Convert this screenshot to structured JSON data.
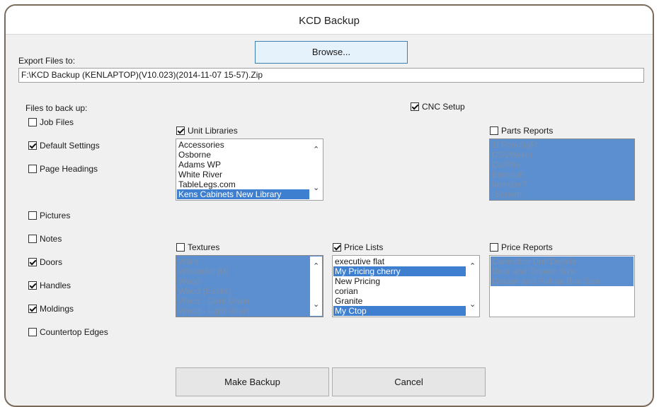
{
  "window": {
    "title": "KCD Backup"
  },
  "export": {
    "label": "Export Files to:",
    "browse_label": "Browse...",
    "path": "F:\\KCD Backup (KENLAPTOP)(V10.023)(2014-11-07 15-57).Zip"
  },
  "files": {
    "heading": "Files to back up:",
    "items": [
      {
        "label": "Job Files",
        "checked": false
      },
      {
        "label": "Default Settings",
        "checked": true
      },
      {
        "label": "Page Headings",
        "checked": false
      },
      {
        "label": "Pictures",
        "checked": false
      },
      {
        "label": "Notes",
        "checked": false
      },
      {
        "label": "Doors",
        "checked": true
      },
      {
        "label": "Handles",
        "checked": true
      },
      {
        "label": "Moldings",
        "checked": true
      },
      {
        "label": "Countertop Edges",
        "checked": false
      }
    ]
  },
  "cnc": {
    "label": "CNC Setup",
    "checked": true
  },
  "unit_libraries": {
    "label": "Unit Libraries",
    "checked": true,
    "items": [
      {
        "text": "Accessories",
        "sel": false
      },
      {
        "text": "Osborne",
        "sel": false
      },
      {
        "text": "Adams WP",
        "sel": false
      },
      {
        "text": "White River",
        "sel": false
      },
      {
        "text": "TableLegs.com",
        "sel": false
      },
      {
        "text": "Kens Cabinets New Library",
        "sel": true
      }
    ]
  },
  "parts_reports": {
    "label": "Parts Reports",
    "checked": false,
    "items": [
      {
        "text": "1f Frm-SqFt",
        "sel": true
      },
      {
        "text": "CSVMaker",
        "sel": true
      },
      {
        "text": "CutRite",
        "sel": true
      },
      {
        "text": "Eurosoft",
        "sel": true
      },
      {
        "text": "Itemizer7",
        "sel": true
      },
      {
        "text": "-Screen",
        "sel": true
      }
    ]
  },
  "textures": {
    "label": "Textures",
    "checked": false,
    "items": [
      {
        "text": "Walls",
        "sel": true
      },
      {
        "text": "WilsonArt (R)",
        "sel": true
      },
      {
        "text": "Wood",
        "sel": true
      },
      {
        "text": "Wood (Exotic)",
        "sel": true
      },
      {
        "text": "Wood - Dark Grain",
        "sel": true
      },
      {
        "text": "Wood - Light Grain",
        "sel": true
      }
    ]
  },
  "price_lists": {
    "label": "Price Lists",
    "checked": true,
    "items": [
      {
        "text": "executive flat",
        "sel": false
      },
      {
        "text": "My Pricing cherry",
        "sel": true
      },
      {
        "text": "New Pricing",
        "sel": false
      },
      {
        "text": "corian",
        "sel": false
      },
      {
        "text": "Granite",
        "sel": false
      },
      {
        "text": "My Ctop",
        "sel": true
      }
    ]
  },
  "price_reports": {
    "label": "Price Reports",
    "checked": false,
    "items": [
      {
        "text": "Cabinotch Unit Details",
        "sel": true
      },
      {
        "text": "Door and Drawer Size",
        "sel": true
      },
      {
        "text": "Drawer and Pullout Box Size",
        "sel": true
      }
    ]
  },
  "actions": {
    "make_backup": "Make Backup",
    "cancel": "Cancel"
  }
}
